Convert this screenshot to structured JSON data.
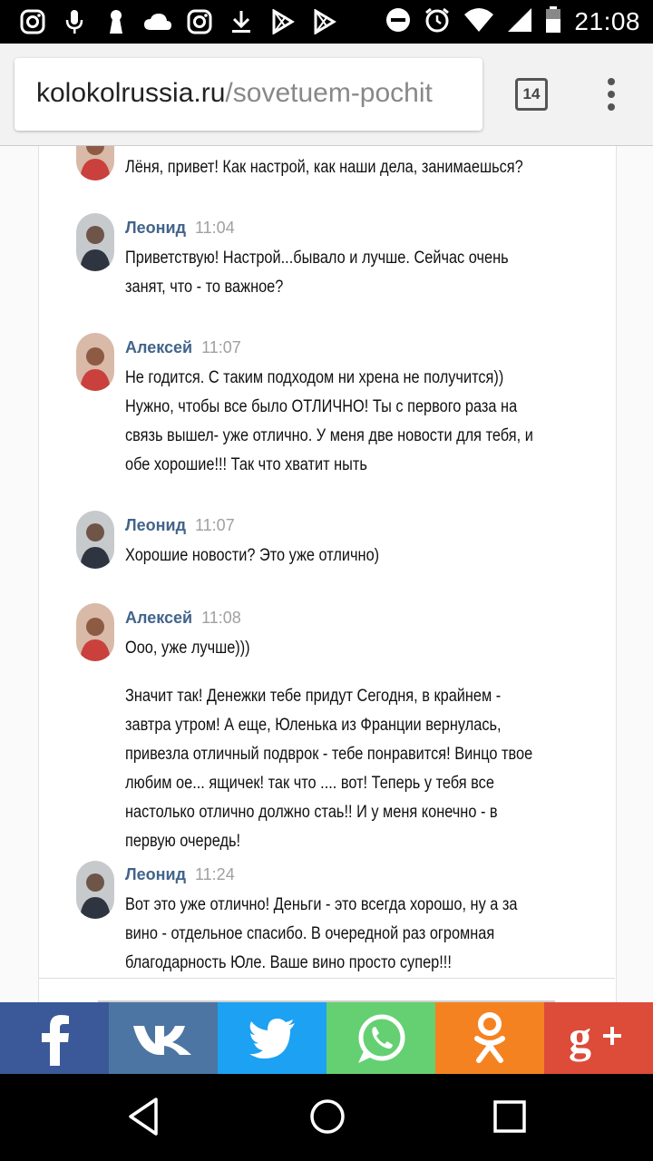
{
  "status_bar": {
    "time": "21:08",
    "icons_left": [
      "instagram-icon",
      "microphone-icon",
      "keyhole-icon",
      "cloud-icon",
      "instagram-icon",
      "download-icon",
      "play-store-icon",
      "play-store-icon"
    ],
    "icons_right": [
      "do-not-disturb-icon",
      "alarm-icon",
      "wifi-icon",
      "signal-icon",
      "battery-icon"
    ]
  },
  "browser": {
    "url_domain": "kolokolrussia.ru",
    "url_path": "/sovetuem-pochit",
    "tab_count": "14"
  },
  "chat": {
    "messages": [
      {
        "name": "",
        "time": "",
        "text": "Лёня, привет! Как настрой, как наши дела, занимаешься?"
      },
      {
        "name": "Леонид",
        "time": "11:04",
        "text": "Приветствую! Настрой...бывало и лучше. Сейчас очень занят, что - то важное?"
      },
      {
        "name": "Алексей",
        "time": "11:07",
        "text": "Не годится. С таким подходом ни хрена не получится)) Нужно, чтобы все было ОТЛИЧНО! Ты с первого раза на связь вышел- уже отлично. У меня две новости для тебя, и обе хорошие!!! Так что хватит ныть"
      },
      {
        "name": "Леонид",
        "time": "11:07",
        "text": "Хорошие новости? Это уже отлично)"
      },
      {
        "name": "Алексей",
        "time": "11:08",
        "text": "Ооо, уже лучше)))"
      },
      {
        "name": "",
        "time": "",
        "text": "Значит так! Денежки тебе придут Сегодня, в крайнем - завтра утром! А еще, Юленька из Франции вернулась, привезла отличный подврок - тебе понравится! Винцо твое любим ое... ящичек! так что .... вот! Теперь у тебя все настолько отлично должно стаь!! И у меня конечно - в первую очередь!"
      },
      {
        "name": "Леонид",
        "time": "11:24",
        "text": "Вот это уже отлично! Деньги - это всегда хорошо, ну а за вино - отдельное спасибо. В очередной раз огромная благодарность Юле. Ваше вино просто супер!!!"
      }
    ]
  },
  "share": {
    "buttons": [
      "facebook-icon",
      "vk-icon",
      "twitter-icon",
      "whatsapp-icon",
      "odnoklassniki-icon",
      "google-plus-icon"
    ],
    "colors": {
      "facebook": "#3b5998",
      "vk": "#4c75a3",
      "twitter": "#1da1f2",
      "whatsapp": "#65d072",
      "odnoklassniki": "#f58220",
      "google_plus": "#dd4b39"
    }
  },
  "nav": {
    "icons": [
      "back-icon",
      "home-icon",
      "recents-icon"
    ]
  }
}
